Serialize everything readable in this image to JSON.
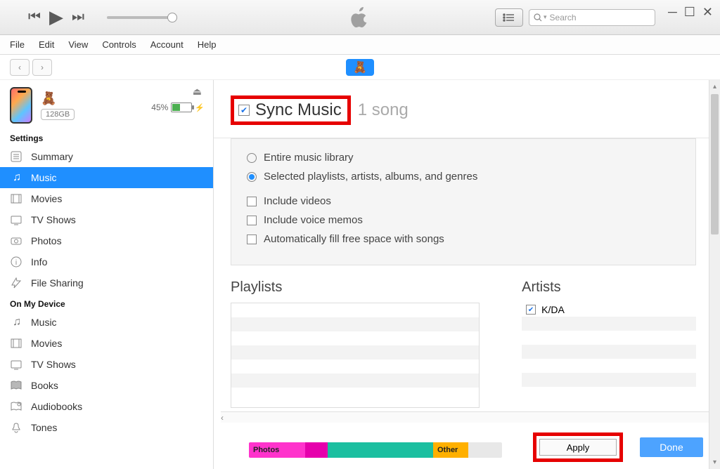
{
  "toolbar": {
    "search_placeholder": "Search"
  },
  "menu": [
    "File",
    "Edit",
    "View",
    "Controls",
    "Account",
    "Help"
  ],
  "device": {
    "capacity_label": "128GB",
    "battery_pct": "45%"
  },
  "sidebar": {
    "section_settings": "Settings",
    "settings_items": [
      {
        "label": "Summary"
      },
      {
        "label": "Music"
      },
      {
        "label": "Movies"
      },
      {
        "label": "TV Shows"
      },
      {
        "label": "Photos"
      },
      {
        "label": "Info"
      },
      {
        "label": "File Sharing"
      }
    ],
    "section_device": "On My Device",
    "device_items": [
      {
        "label": "Music"
      },
      {
        "label": "Movies"
      },
      {
        "label": "TV Shows"
      },
      {
        "label": "Books"
      },
      {
        "label": "Audiobooks"
      },
      {
        "label": "Tones"
      }
    ]
  },
  "content": {
    "sync_title": "Sync Music",
    "song_count": "1 song",
    "radio_entire": "Entire music library",
    "radio_selected": "Selected playlists, artists, albums, and genres",
    "include_videos": "Include videos",
    "include_voice": "Include voice memos",
    "autofill": "Automatically fill free space with songs",
    "playlists_title": "Playlists",
    "artists_title": "Artists",
    "artist0": "K/DA"
  },
  "storage": {
    "photos": "Photos",
    "other": "Other"
  },
  "buttons": {
    "apply": "Apply",
    "done": "Done"
  }
}
